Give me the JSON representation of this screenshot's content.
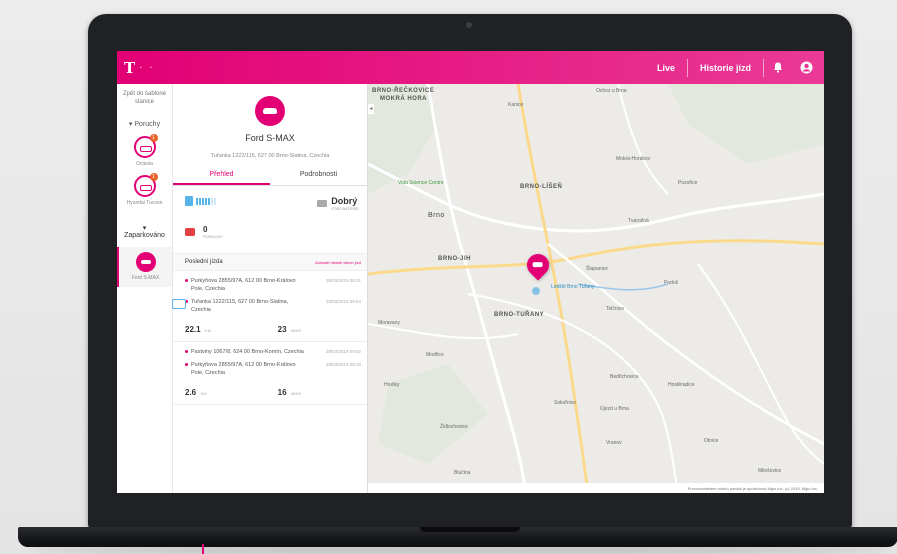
{
  "topbar": {
    "logo": "T",
    "logo_dots": "· ·",
    "links": [
      "Live",
      "Historie jízd"
    ],
    "icons": [
      "bell-icon",
      "account-icon"
    ],
    "accent": "#e20074"
  },
  "leftnav": {
    "top_link": "Zpět do šabloné stanice",
    "section_label": "Poruchy",
    "cars": [
      {
        "label": "Octavia",
        "badge": "1"
      },
      {
        "label": "Hyundai Tucson",
        "badge": "1"
      }
    ],
    "parked_label": "Zaparkováno",
    "active_car_label": "Ford S-MAX"
  },
  "panel": {
    "car_name": "Ford S-MAX",
    "address": "Tuřanka 1222/115, 627 00 Brno-Slatina, Czechia",
    "tabs": [
      "Přehled",
      "Podrobnosti"
    ],
    "fuel": {
      "level_bars": 5,
      "total_bars": 7,
      "suffix": "1"
    },
    "battery": {
      "value": "Dobrý",
      "label": "STAV BATERIE"
    },
    "faults": {
      "count": "0",
      "label": "PORUCHY"
    },
    "trips_header": "Poslední jízda",
    "trips_link": "Zobrazit historii všech jízd",
    "trips": [
      {
        "from": "Purkyňova 2855/97A, 612 00 Brno-Královo Pole, Czechia",
        "from_time": "28/03/2019 09:31",
        "to": "Tuřanka 1222/115, 627 00 Brno-Slatina, Czechia",
        "to_time": "28/03/2019 09:54",
        "distance": "22.1",
        "distance_unit": "KM",
        "duration": "23",
        "duration_unit": "MINS"
      },
      {
        "from": "Pastviny 1067/8, 624 00 Brno-Komín, Czechia",
        "from_time": "28/03/2019 09:02",
        "to": "Purkyňova 2855/97A, 612 00 Brno-Královo Pole, Czechia",
        "to_time": "28/03/2019 09:18",
        "distance": "2.6",
        "distance_unit": "KM",
        "duration": "16",
        "duration_unit": "MINS"
      }
    ]
  },
  "map": {
    "labels": [
      {
        "text": "BRNO-ŘEČKOVICE",
        "cls": "city"
      },
      {
        "text": "MOKRÁ HORA",
        "cls": "city"
      },
      {
        "text": "Brno",
        "cls": "big"
      },
      {
        "text": "BRNO-LÍŠEŇ",
        "cls": "city"
      },
      {
        "text": "BRNO-JIH",
        "cls": "city"
      },
      {
        "text": "BRNO-TUŘANY",
        "cls": "city"
      },
      {
        "text": "Vida Science Centre",
        "cls": "green"
      },
      {
        "text": "Letiště Brno Tuřany",
        "cls": "blue"
      },
      {
        "text": "Ochoz u Brna",
        "cls": ""
      },
      {
        "text": "Kanice",
        "cls": ""
      },
      {
        "text": "Mokrá-Horákov",
        "cls": ""
      },
      {
        "text": "Pozořice",
        "cls": ""
      },
      {
        "text": "Tvarožná",
        "cls": ""
      },
      {
        "text": "Šlapanice",
        "cls": ""
      },
      {
        "text": "Podoli",
        "cls": ""
      },
      {
        "text": "Telčnice",
        "cls": ""
      },
      {
        "text": "Modřice",
        "cls": ""
      },
      {
        "text": "Moravany",
        "cls": ""
      },
      {
        "text": "Židlochovice",
        "cls": ""
      },
      {
        "text": "Blučina",
        "cls": ""
      },
      {
        "text": "Sokoľnice",
        "cls": ""
      },
      {
        "text": "Hrušky",
        "cls": ""
      },
      {
        "text": "Vranov",
        "cls": ""
      },
      {
        "text": "Bedřichovice",
        "cls": ""
      },
      {
        "text": "Hostěradice",
        "cls": ""
      },
      {
        "text": "Újezd u Brna",
        "cls": ""
      },
      {
        "text": "Otnice",
        "cls": ""
      },
      {
        "text": "Milešovice",
        "cls": ""
      }
    ],
    "copyright": "Map data ©2019 Google",
    "footer_text": "Provozovatelem tohoto portálu je společnost Mgio Inc. (c) 2019, Mgio Inc."
  }
}
